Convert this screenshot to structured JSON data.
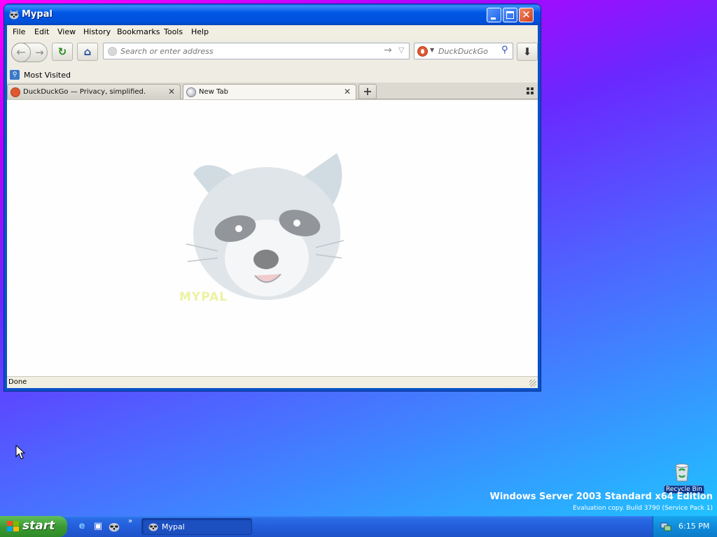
{
  "window": {
    "title": "Mypal",
    "menu": [
      "File",
      "Edit",
      "View",
      "History",
      "Bookmarks",
      "Tools",
      "Help"
    ]
  },
  "navbar": {
    "url_placeholder": "Search or enter address",
    "search_placeholder": "DuckDuckGo"
  },
  "bookmarks": {
    "most_visited": "Most Visited"
  },
  "tabs": [
    {
      "label": "DuckDuckGo — Privacy, simplified.",
      "active": false
    },
    {
      "label": "New Tab",
      "active": true
    }
  ],
  "content": {
    "watermark": "MYPAL"
  },
  "status": {
    "text": "Done"
  },
  "desktop": {
    "recycle_bin": "Recycle Bin",
    "os_title": "Windows Server 2003 Standard x64 Edition",
    "os_sub": "Evaluation copy. Build 3790 (Service Pack 1)"
  },
  "taskbar": {
    "start": "start",
    "task_label": "Mypal",
    "clock": "6:15 PM"
  },
  "colors": {
    "titlebar": "#0058e6",
    "start_green": "#3c9a34",
    "ddg_orange": "#de5833"
  }
}
